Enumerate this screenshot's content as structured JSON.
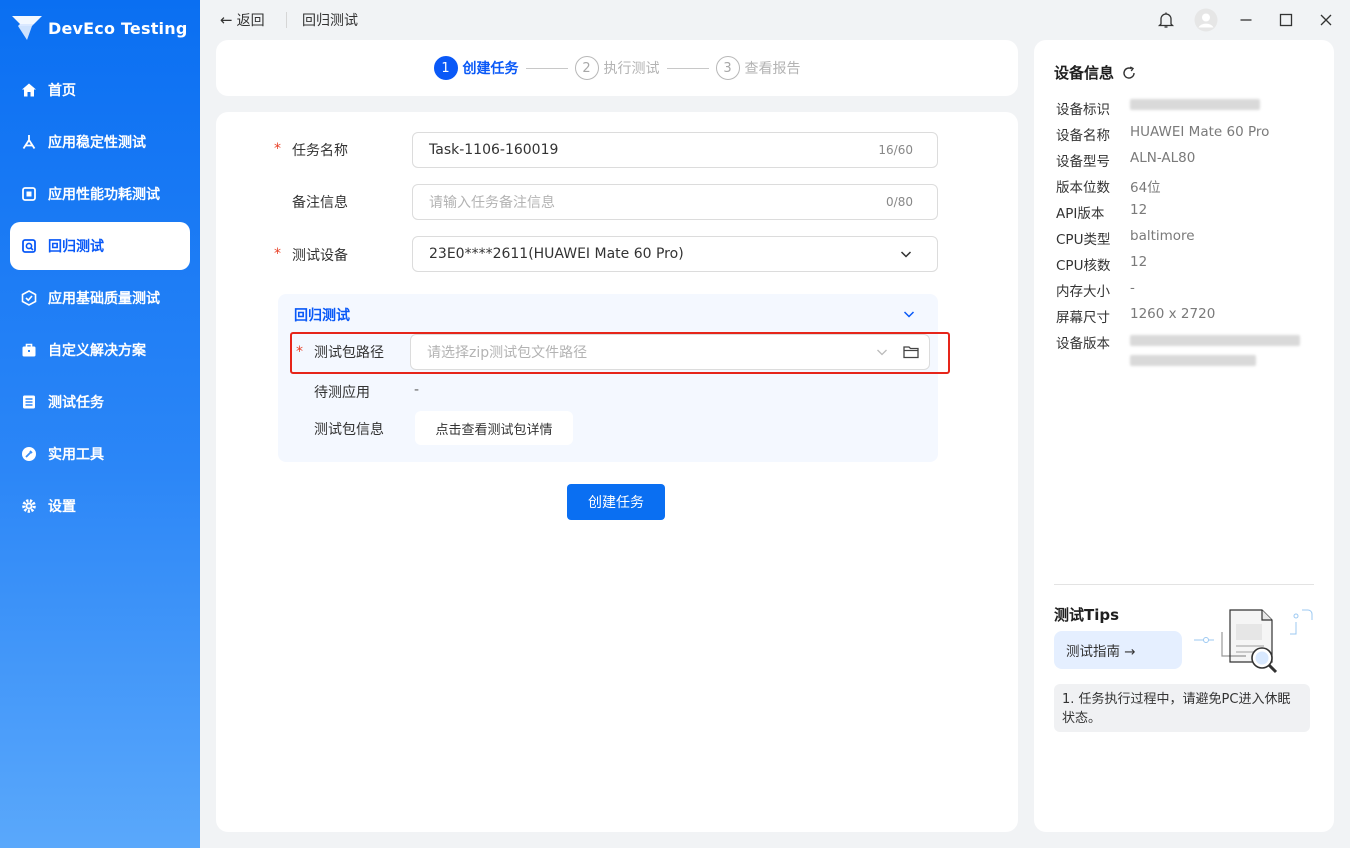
{
  "app": {
    "name": "DevEco Testing"
  },
  "sidebar": {
    "items": [
      {
        "label": "首页",
        "icon": "home-icon"
      },
      {
        "label": "应用稳定性测试",
        "icon": "stability-icon"
      },
      {
        "label": "应用性能功耗测试",
        "icon": "performance-icon"
      },
      {
        "label": "回归测试",
        "icon": "regression-icon",
        "active": true
      },
      {
        "label": "应用基础质量测试",
        "icon": "quality-check-icon"
      },
      {
        "label": "自定义解决方案",
        "icon": "briefcase-icon"
      },
      {
        "label": "测试任务",
        "icon": "task-list-icon"
      },
      {
        "label": "实用工具",
        "icon": "tools-icon"
      },
      {
        "label": "设置",
        "icon": "gear-icon"
      }
    ]
  },
  "topbar": {
    "back_label": "返回",
    "title": "回归测试"
  },
  "steps": [
    {
      "num": "1",
      "label": "创建任务",
      "active": true
    },
    {
      "num": "2",
      "label": "执行测试",
      "active": false
    },
    {
      "num": "3",
      "label": "查看报告",
      "active": false
    }
  ],
  "form": {
    "task_name": {
      "label": "任务名称",
      "value": "Task-1106-160019",
      "count": "16/60",
      "required": true
    },
    "remark": {
      "label": "备注信息",
      "placeholder": "请输入任务备注信息",
      "count": "0/80",
      "required": false
    },
    "device": {
      "label": "测试设备",
      "value": "23E0****2611(HUAWEI Mate 60 Pro)",
      "required": true
    },
    "section": {
      "title": "回归测试",
      "package_path": {
        "label": "测试包路径",
        "placeholder": "请选择zip测试包文件路径",
        "required": true
      },
      "target_app": {
        "label": "待测应用",
        "value": "-"
      },
      "package_info": {
        "label": "测试包信息",
        "button": "点击查看测试包详情"
      }
    },
    "submit_label": "创建任务"
  },
  "device_info": {
    "title": "设备信息",
    "rows": [
      {
        "key": "设备标识",
        "value": "",
        "blurred": true
      },
      {
        "key": "设备名称",
        "value": "HUAWEI Mate 60 Pro"
      },
      {
        "key": "设备型号",
        "value": "ALN-AL80"
      },
      {
        "key": "版本位数",
        "value": "64位"
      },
      {
        "key": "API版本",
        "value": "12"
      },
      {
        "key": "CPU类型",
        "value": "baltimore"
      },
      {
        "key": "CPU核数",
        "value": "12"
      },
      {
        "key": "内存大小",
        "value": "-"
      },
      {
        "key": "屏幕尺寸",
        "value": "1260 x 2720"
      },
      {
        "key": "设备版本",
        "value": "",
        "blurred": true
      }
    ]
  },
  "tips": {
    "title": "测试Tips",
    "guide_label": "测试指南 →",
    "items": [
      "1. 任务执行过程中，请避免PC进入休眠状态。"
    ]
  },
  "colors": {
    "accent": "#0a59f7",
    "required": "#e84026",
    "highlight_box": "#e6251a"
  }
}
